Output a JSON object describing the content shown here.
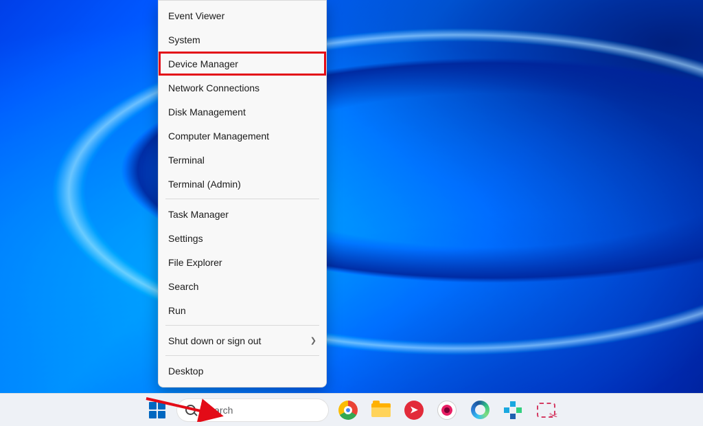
{
  "context_menu": {
    "items": [
      {
        "label": "Event Viewer",
        "has_submenu": false
      },
      {
        "label": "System",
        "has_submenu": false
      },
      {
        "label": "Device Manager",
        "has_submenu": false,
        "highlighted": true
      },
      {
        "label": "Network Connections",
        "has_submenu": false
      },
      {
        "label": "Disk Management",
        "has_submenu": false
      },
      {
        "label": "Computer Management",
        "has_submenu": false
      },
      {
        "label": "Terminal",
        "has_submenu": false
      },
      {
        "label": "Terminal (Admin)",
        "has_submenu": false
      },
      {
        "separator_after": true
      },
      {
        "label": "Task Manager",
        "has_submenu": false
      },
      {
        "label": "Settings",
        "has_submenu": false
      },
      {
        "label": "File Explorer",
        "has_submenu": false
      },
      {
        "label": "Search",
        "has_submenu": false
      },
      {
        "label": "Run",
        "has_submenu": false
      },
      {
        "separator_after": true
      },
      {
        "label": "Shut down or sign out",
        "has_submenu": true
      },
      {
        "separator_after": true
      },
      {
        "label": "Desktop",
        "has_submenu": false
      }
    ]
  },
  "taskbar": {
    "search_placeholder": "Search",
    "icons": [
      {
        "name": "start-button"
      },
      {
        "name": "search-box"
      },
      {
        "name": "chrome-icon"
      },
      {
        "name": "file-explorer-icon"
      },
      {
        "name": "mail-app-icon"
      },
      {
        "name": "media-app-icon"
      },
      {
        "name": "edge-icon"
      },
      {
        "name": "utility-app-icon"
      },
      {
        "name": "snip-tool-icon"
      }
    ]
  },
  "annotation": {
    "highlight_target": "Device Manager",
    "arrow_points_to": "start-button"
  }
}
